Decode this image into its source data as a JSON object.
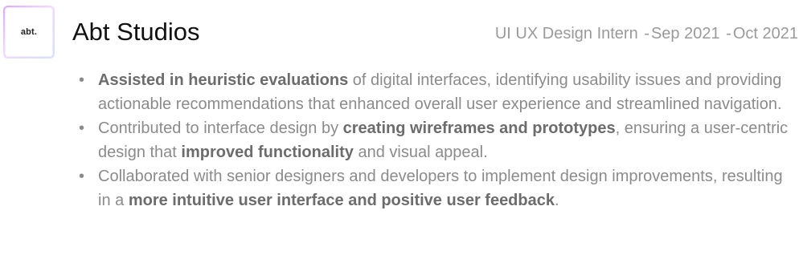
{
  "experience": {
    "logo_text": "abt.",
    "company": "Abt Studios",
    "role": "UI UX Design Intern",
    "separator": "-",
    "start": "Sep 2021",
    "end": "Oct 2021",
    "bullets": [
      {
        "segments": [
          {
            "text": "Assisted in heuristic evaluations",
            "bold": true
          },
          {
            "text": " of digital interfaces, identifying usability issues and providing actionable recommendations that enhanced overall user experience and streamlined navigation.",
            "bold": false
          }
        ]
      },
      {
        "segments": [
          {
            "text": "Contributed to interface design by ",
            "bold": false
          },
          {
            "text": "creating wireframes and prototypes",
            "bold": true
          },
          {
            "text": ", ensuring a user-centric design that ",
            "bold": false
          },
          {
            "text": "improved functionality",
            "bold": true
          },
          {
            "text": " and visual appeal.",
            "bold": false
          }
        ]
      },
      {
        "segments": [
          {
            "text": "Collaborated with senior designers and developers to implement design improvements, resulting in a ",
            "bold": false
          },
          {
            "text": "more intuitive user interface and positive user feedback",
            "bold": true
          },
          {
            "text": ".",
            "bold": false
          }
        ]
      }
    ],
    "bullet_symbol": "•"
  },
  "colors": {
    "title": "#111111",
    "body_text": "#8b8b8b",
    "bold_text": "#6c6c6c",
    "meta_text": "#9a9a9a",
    "logo_border_gradient": [
      "#d9a8ff",
      "#f3d7ff",
      "#cfe3ff"
    ]
  }
}
